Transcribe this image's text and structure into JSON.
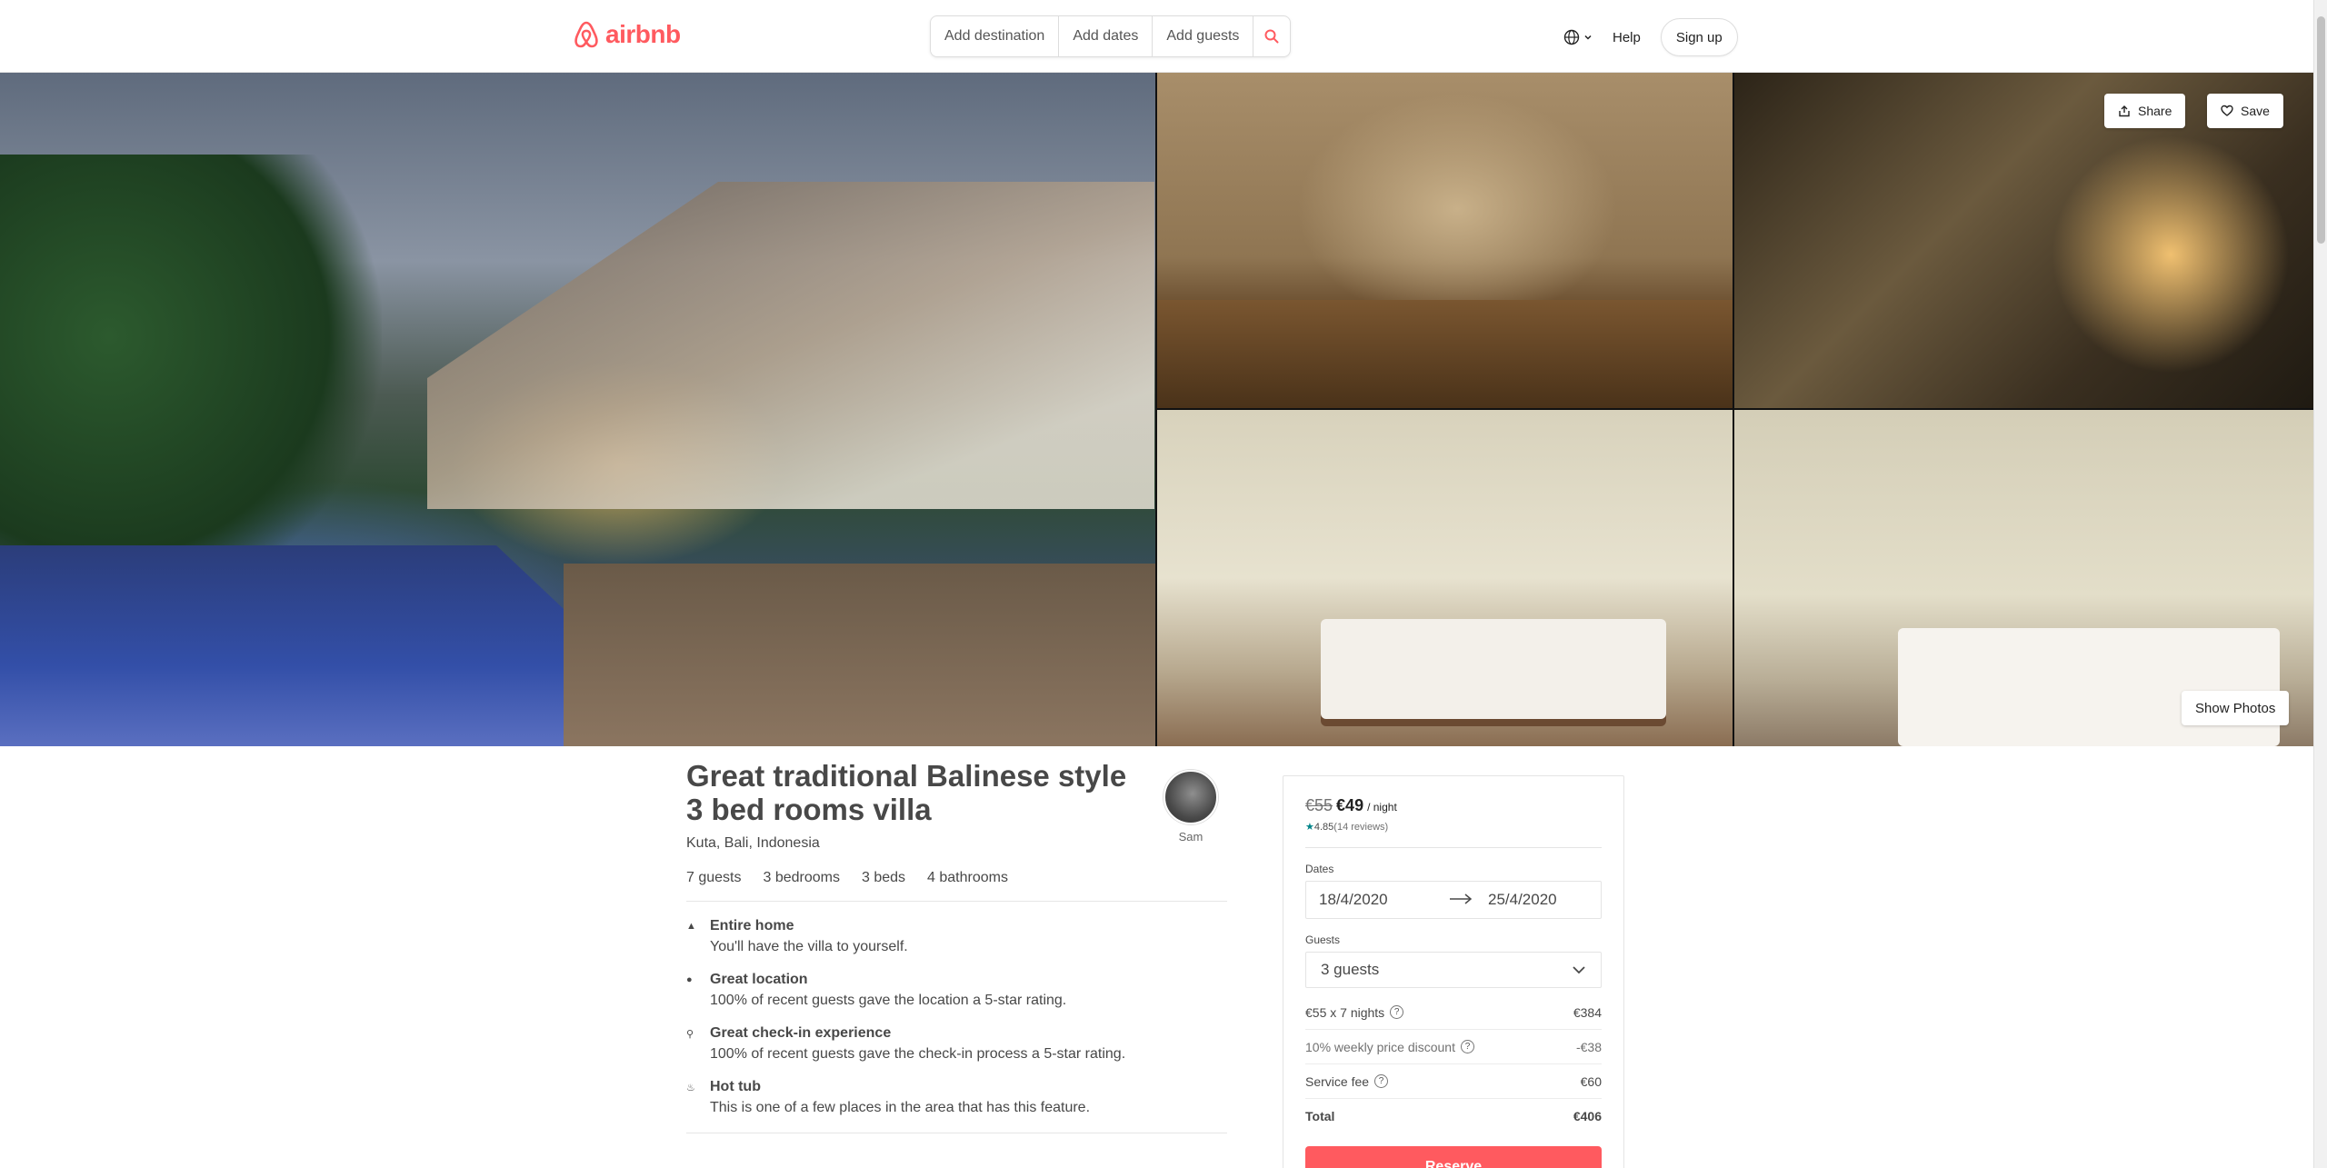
{
  "header": {
    "logo_text": "airbnb",
    "search": {
      "destination_placeholder": "Add destination",
      "dates_placeholder": "Add dates",
      "guests_placeholder": "Add guests"
    },
    "help_label": "Help",
    "signup_label": "Sign up"
  },
  "gallery": {
    "share_label": "Share",
    "save_label": "Save",
    "show_photos_label": "Show Photos"
  },
  "listing": {
    "title": "Great traditional Balinese style 3 bed rooms villa",
    "location": "Kuta, Bali, Indonesia",
    "host_name": "Sam",
    "facts": [
      "7 guests",
      "3 bedrooms",
      "3 beds",
      "4 bathrooms"
    ],
    "features": [
      {
        "icon": "home-icon",
        "title": "Entire home",
        "desc": "You'll have the villa to yourself."
      },
      {
        "icon": "location-pin-icon",
        "title": "Great location",
        "desc": "100% of recent guests gave the location a 5-star rating."
      },
      {
        "icon": "key-icon",
        "title": "Great check-in experience",
        "desc": "100% of recent guests gave the check-in process a 5-star rating."
      },
      {
        "icon": "hot-tub-icon",
        "title": "Hot tub",
        "desc": "This is one of a few places in the area that has this feature."
      }
    ]
  },
  "booking": {
    "old_price": "€55",
    "new_price": "€49",
    "per_night": "/ night",
    "rating": "4.85",
    "reviews": "(14 reviews)",
    "dates_label": "Dates",
    "check_in": "18/4/2020",
    "check_out": "25/4/2020",
    "guests_label": "Guests",
    "guests_value": "3 guests",
    "lines": [
      {
        "label": "€55 x 7 nights",
        "value": "€384"
      },
      {
        "label": "10% weekly price discount",
        "value": "-€38"
      },
      {
        "label": "Service fee",
        "value": "€60"
      }
    ],
    "total_label": "Total",
    "total_value": "€406",
    "reserve_label": "Reserve"
  },
  "colors": {
    "brand": "#ff5a5f",
    "rating_accent": "#008489"
  }
}
